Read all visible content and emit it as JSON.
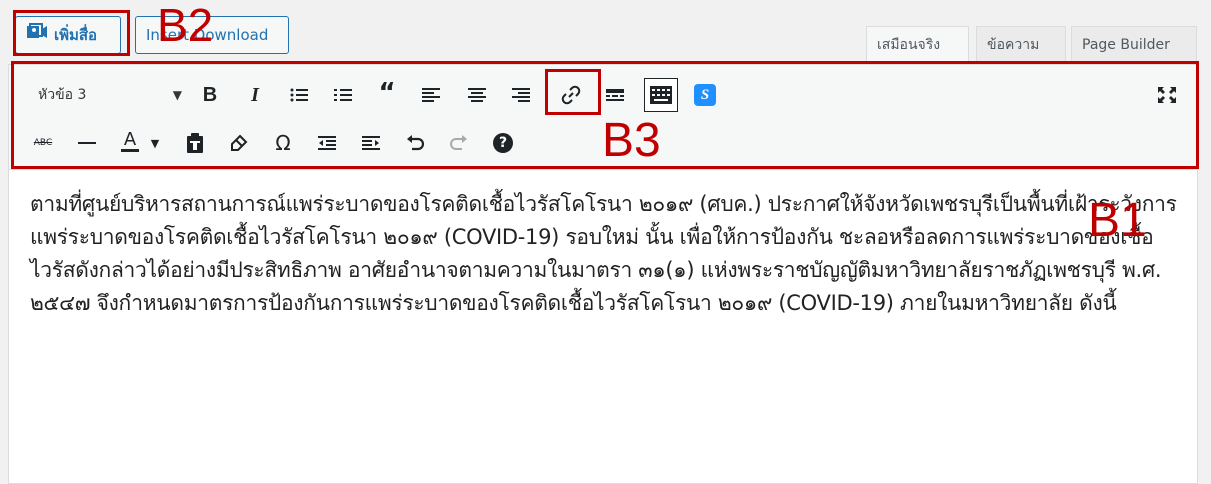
{
  "media_buttons": {
    "add_media_label": "เพิ่มสื่อ",
    "insert_download_label": "Insert Download"
  },
  "editor_tabs": [
    {
      "label": "เสมือนจริง",
      "active": true
    },
    {
      "label": "ข้อความ",
      "active": false
    },
    {
      "label": "Page Builder",
      "active": false
    }
  ],
  "toolbar": {
    "format_select_value": "หัวข้อ 3",
    "text_color_glyph": "A",
    "omega_glyph": "Ω",
    "strikethrough_glyph": "ABC"
  },
  "annotations": {
    "b1": "B1",
    "b2": "B2",
    "b3": "B3"
  },
  "content": {
    "paragraph": "ตามที่ศูนย์บริหารสถานการณ์แพร่ระบาดของโรคติดเชื้อไวรัสโคโรนา ๒๐๑๙ (ศบค.) ประกาศให้จังหวัดเพชรบุรีเป็นพื้นที่เฝ้าระวังการแพร่ระบาดของโรคติดเชื้อไวรัสโคโรนา ๒๐๑๙ (COVID-19) รอบใหม่ นั้น เพื่อให้การป้องกัน ชะลอหรือลดการแพร่ระบาดของเชื้อไวรัสดังกล่าวได้อย่างมีประสิทธิภาพ อาศัยอำนาจตามความในมาตรา ๓๑(๑) แห่งพระราชบัญญัติมหาวิทยาลัยราชภัฏเพชรบุรี พ.ศ. ๒๕๔๗ จึงกำหนดมาตรการป้องกันการแพร่ระบาดของโรคติดเชื้อไวรัสโคโรนา ๒๐๑๙ (COVID-19) ภายในมหาวิทยาลัย ดังนี้"
  },
  "colors": {
    "annotation_red": "#c00000",
    "wp_blue": "#2271b1"
  }
}
